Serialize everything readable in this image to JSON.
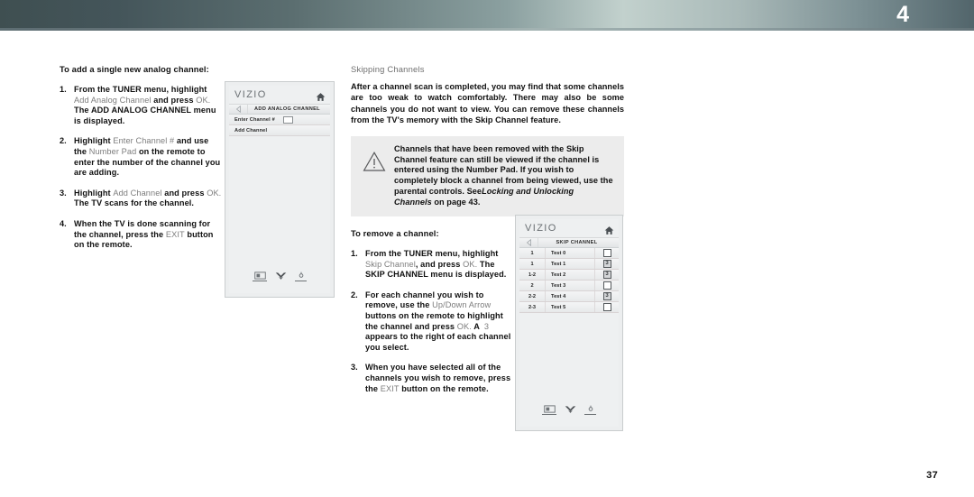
{
  "banner": {
    "chapter_number": "4"
  },
  "page": {
    "number": "37"
  },
  "left_column": {
    "heading": "To add a single new analog channel:",
    "steps": [
      {
        "marker": "1.",
        "text": "From the TUNER menu, highlight Add Analog Channel  and press OK. The ADD ANALOG CHANNEL menu is displayed."
      },
      {
        "marker": "2.",
        "text": "Highlight Enter Channel # and use the Number Pad on the remote to enter the number of the channel you are adding."
      },
      {
        "marker": "3.",
        "text": "Highlight Add Channel and press OK. The TV scans for the channel."
      },
      {
        "marker": "4.",
        "text": "When the TV is done scanning for the channel, press the EXIT button on the remote."
      }
    ]
  },
  "right_column": {
    "section_title": "Skipping Channels",
    "paragraph": "After a channel scan is completed, you may find that some channels are too weak to watch comfortably. There may also be some channels you do not want to view. You can remove these channels from the TV's memory with the Skip Channel feature.",
    "caution": {
      "icon": "warning-triangle-icon",
      "text": "Channels that have been removed with the Skip Channel feature can still be viewed if the channel is entered using the Number Pad. If you wish to completely block a channel from being viewed, use the parental controls. See Locking and Unlocking Channels on page 43.",
      "reference_italic": "Locking and Unlocking Channels",
      "reference_page": "43",
      "background_color": "#ececec"
    },
    "remove_heading": "To remove a channel:",
    "remove_steps": [
      {
        "marker": "1.",
        "text": "From the TUNER menu, highlight Skip Channel, and press OK. The SKIP CHANNEL menu is displayed."
      },
      {
        "marker": "2.",
        "text": "For each channel you wish to remove, use the Up/Down Arrow buttons on the remote to highlight the channel and press OK. A  3 appears to the right of each channel you select."
      },
      {
        "marker": "3.",
        "text": "When you have selected all of the channels you wish to remove, press the EXIT button on the remote."
      }
    ]
  },
  "tv_screen_1": {
    "brand": "VIZIO",
    "home_icon": "home-icon",
    "back_icon": "back-arrow-icon",
    "menu_title": "ADD ANALOG CHANNEL",
    "rows": [
      {
        "label": "Enter Channel #",
        "has_input": true,
        "input_value": ""
      },
      {
        "label": "Add Channel",
        "has_input": false
      }
    ],
    "footer_icons": [
      "picture-icon",
      "chevron-double-down-icon",
      "brightness-icon"
    ]
  },
  "tv_screen_2": {
    "brand": "VIZIO",
    "home_icon": "home-icon",
    "back_icon": "back-arrow-icon",
    "menu_title": "SKIP CHANNEL",
    "channels": [
      {
        "number": "1",
        "name": "Test 0",
        "checked": false,
        "check_glyph": ""
      },
      {
        "number": "1",
        "name": "Test 1",
        "checked": true,
        "check_glyph": "3"
      },
      {
        "number": "1-2",
        "name": "Test 2",
        "checked": true,
        "check_glyph": "3"
      },
      {
        "number": "2",
        "name": "Test 3",
        "checked": false,
        "check_glyph": ""
      },
      {
        "number": "2-2",
        "name": "Test 4",
        "checked": true,
        "check_glyph": "3"
      },
      {
        "number": "2-3",
        "name": "Test 5",
        "checked": false,
        "check_glyph": ""
      }
    ],
    "footer_icons": [
      "picture-icon",
      "chevron-double-down-icon",
      "brightness-icon"
    ]
  }
}
